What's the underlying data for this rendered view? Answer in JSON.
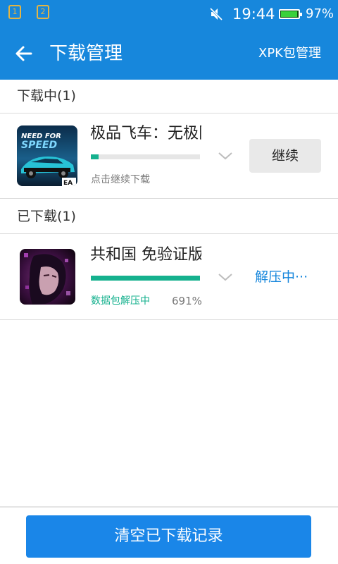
{
  "status_bar": {
    "notification_1": "1",
    "notification_2": "2",
    "time": "19:44",
    "battery_percent": "97%",
    "battery_level": 0.97,
    "icons": [
      "notification-1-icon",
      "notification-2-icon",
      "mute-icon",
      "battery-icon"
    ]
  },
  "header": {
    "title": "下载管理",
    "xpk_label": "XPK包管理"
  },
  "downloading": {
    "section_label": "下载中(1)",
    "items": [
      {
        "name": "极品飞车：无极限",
        "status": "点击继续下载",
        "progress": 0.07,
        "action_label": "继续",
        "icon_text": "NEED FOR SPEED"
      }
    ]
  },
  "downloaded": {
    "section_label": "已下载(1)",
    "items": [
      {
        "name": "共和国 免验证版",
        "status": "数据包解压中",
        "percent": "691%",
        "progress": 1.0,
        "action_label": "解压中···"
      }
    ]
  },
  "footer": {
    "clear_label": "清空已下载记录"
  },
  "colors": {
    "primary": "#1787dc",
    "progress": "#15b18e",
    "notification": "#e3b443"
  }
}
